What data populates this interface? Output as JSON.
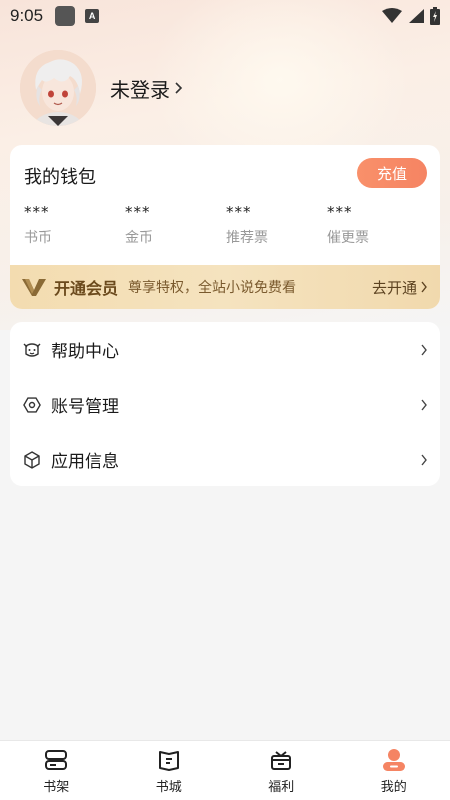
{
  "status_bar": {
    "time": "9:05",
    "badge": "A",
    "icons": [
      "wifi-icon",
      "signal-icon",
      "battery-icon"
    ]
  },
  "profile": {
    "login_text": "未登录",
    "avatar_icon": "anime-avatar"
  },
  "wallet": {
    "title": "我的钱包",
    "recharge_label": "充值",
    "stats": [
      {
        "value": "***",
        "label": "书币"
      },
      {
        "value": "***",
        "label": "金币"
      },
      {
        "value": "***",
        "label": "推荐票"
      },
      {
        "value": "***",
        "label": "催更票"
      }
    ],
    "vip": {
      "title": "开通会员",
      "desc": "尊享特权，全站小说免费看",
      "action": "去开通"
    }
  },
  "menu": {
    "items": [
      {
        "label": "帮助中心",
        "icon": "help-robot-icon"
      },
      {
        "label": "账号管理",
        "icon": "hexagon-settings-icon"
      },
      {
        "label": "应用信息",
        "icon": "cube-info-icon"
      }
    ]
  },
  "bottom_nav": {
    "items": [
      {
        "label": "书架",
        "icon": "bookshelf-icon"
      },
      {
        "label": "书城",
        "icon": "bookstore-icon"
      },
      {
        "label": "福利",
        "icon": "gift-icon"
      },
      {
        "label": "我的",
        "icon": "profile-icon"
      }
    ],
    "active_index": 3
  },
  "colors": {
    "accent": "#f58463",
    "vip_gold": "#f3dcb0",
    "vip_text": "#6b4a1d"
  }
}
